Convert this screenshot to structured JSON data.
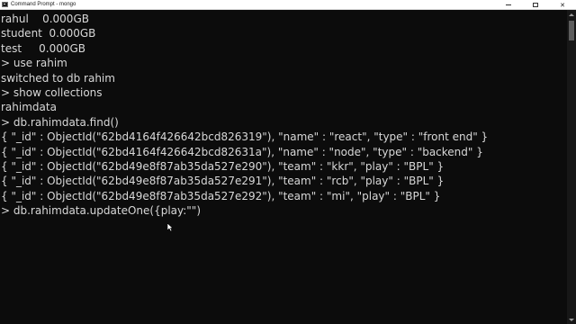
{
  "window": {
    "title": "Command Prompt - mongo",
    "icon": "terminal-icon"
  },
  "console": {
    "lines": [
      "rahul    0.000GB",
      "student  0.000GB",
      "test     0.000GB",
      "> use rahim",
      "switched to db rahim",
      "> show collections",
      "rahimdata",
      "> db.rahimdata.find()",
      "{ \"_id\" : ObjectId(\"62bd4164f426642bcd826319\"), \"name\" : \"react\", \"type\" : \"front end\" }",
      "{ \"_id\" : ObjectId(\"62bd4164f426642bcd82631a\"), \"name\" : \"node\", \"type\" : \"backend\" }",
      "{ \"_id\" : ObjectId(\"62bd49e8f87ab35da527e290\"), \"team\" : \"kkr\", \"play\" : \"BPL\" }",
      "{ \"_id\" : ObjectId(\"62bd49e8f87ab35da527e291\"), \"team\" : \"rcb\", \"play\" : \"BPL\" }",
      "{ \"_id\" : ObjectId(\"62bd49e8f87ab35da527e292\"), \"team\" : \"mi\", \"play\" : \"BPL\" }",
      "> db.rahimdata.updateOne({play:\"\")"
    ]
  },
  "colors": {
    "background": "#0c0c0c",
    "text": "#d8d8d8",
    "titlebar": "#ffffff"
  }
}
